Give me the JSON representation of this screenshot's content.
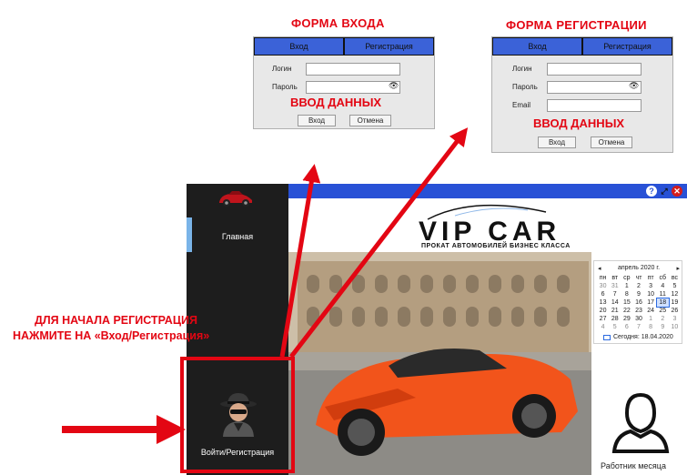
{
  "annotations": {
    "login_form_title": "ФОРМА ВХОДА",
    "register_form_title": "ФОРМА РЕГИСТРАЦИИ",
    "instruction_line1": "ДЛЯ НАЧАЛА РЕГИСТРАЦИЯ",
    "instruction_line2": "НАЖМИТЕ НА «Вход/Регистрация»"
  },
  "login_form": {
    "tab_login": "Вход",
    "tab_register": "Регистрация",
    "login_label": "Логин",
    "password_label": "Пароль",
    "data_entry": "ВВОД ДАННЫХ",
    "submit_button": "Вход",
    "cancel_button": "Отмена"
  },
  "register_form": {
    "tab_login": "Вход",
    "tab_register": "Регистрация",
    "login_label": "Логин",
    "password_label": "Пароль",
    "email_label": "Email",
    "data_entry": "ВВОД ДАННЫХ",
    "submit_button": "Вход",
    "cancel_button": "Отмена"
  },
  "app": {
    "window_buttons": [
      "?",
      "⤢",
      "✕"
    ],
    "sidebar": {
      "home_label": "Главная",
      "login_register_label": "Войти/Регистрация"
    },
    "logo": {
      "text": "VIP CAR",
      "tagline": "ПРОКАТ АВТОМОБИЛЕЙ БИЗНЕС КЛАССА"
    },
    "calendar": {
      "month": "апрель 2020 г.",
      "prev": "◂",
      "next": "▸",
      "weekdays": [
        "пн",
        "вт",
        "ср",
        "чт",
        "пт",
        "сб",
        "вс"
      ],
      "days": [
        "30",
        "31",
        "1",
        "2",
        "3",
        "4",
        "5",
        "6",
        "7",
        "8",
        "9",
        "10",
        "11",
        "12",
        "13",
        "14",
        "15",
        "16",
        "17",
        "18",
        "19",
        "20",
        "21",
        "22",
        "23",
        "24",
        "25",
        "26",
        "27",
        "28",
        "29",
        "30",
        "1",
        "2",
        "3",
        "4",
        "5",
        "6",
        "7",
        "8",
        "9",
        "10"
      ],
      "today_footer": "Сегодня: 18.04.2020"
    },
    "employee_of_month": "Работник месяца"
  },
  "colors": {
    "accent_red": "#e30613",
    "title_bar_blue": "#2851d6",
    "tab_blue": "#3b62d8",
    "sidebar_dark": "#1d1d1d",
    "car_orange": "#f2541b"
  }
}
